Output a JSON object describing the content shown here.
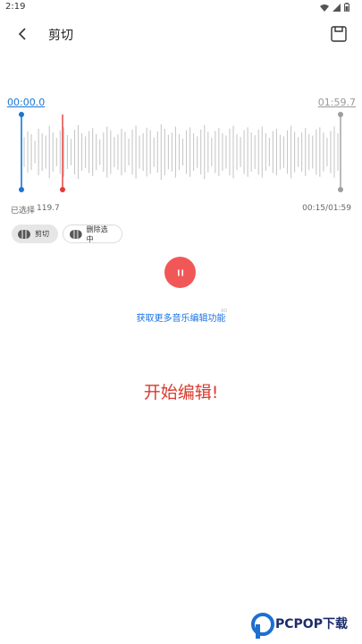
{
  "status_bar": {
    "time": "2:19",
    "icons": [
      "wifi-icon",
      "signal-icon",
      "battery-icon"
    ]
  },
  "app_bar": {
    "title": "剪切",
    "back_icon": "chevron-left-icon",
    "save_icon": "save-icon"
  },
  "timeline": {
    "start_time": "00:00.0",
    "end_time": "01:59.7"
  },
  "waveform": {
    "colors": {
      "wave": "#c8c8c8",
      "start_handle": "#1976d2",
      "playhead": "#e53935",
      "end_handle": "#9e9e9e"
    },
    "playhead_position_fraction": 0.125,
    "amplitudes": [
      0.4,
      0.55,
      0.48,
      0.3,
      0.62,
      0.5,
      0.44,
      0.7,
      0.52,
      0.38,
      0.58,
      0.66,
      0.45,
      0.35,
      0.6,
      0.72,
      0.5,
      0.42,
      0.56,
      0.64,
      0.48,
      0.34,
      0.52,
      0.68,
      0.58,
      0.4,
      0.47,
      0.62,
      0.54,
      0.36,
      0.6,
      0.7,
      0.44,
      0.5,
      0.65,
      0.58,
      0.39,
      0.55,
      0.74,
      0.62,
      0.46,
      0.52,
      0.68,
      0.48,
      0.36,
      0.58,
      0.66,
      0.5,
      0.42,
      0.6,
      0.72,
      0.54,
      0.38,
      0.56,
      0.64,
      0.5,
      0.44,
      0.62,
      0.7,
      0.48,
      0.4,
      0.58,
      0.66,
      0.52,
      0.45,
      0.6,
      0.68,
      0.5,
      0.38,
      0.56,
      0.62,
      0.46,
      0.42,
      0.58,
      0.7,
      0.54,
      0.4,
      0.52,
      0.64,
      0.48,
      0.44,
      0.6,
      0.66,
      0.52,
      0.38,
      0.56,
      0.68,
      0.5
    ]
  },
  "selection": {
    "label": "已选择",
    "value": "119.7",
    "position_readout": "00:15/01:59"
  },
  "actions": {
    "cut_label": "剪切",
    "delete_selected_label": "删除选中"
  },
  "player": {
    "state": "playing",
    "button_icon": "pause-icon",
    "color": "#f25757"
  },
  "promo": {
    "link_text": "获取更多音乐编辑功能",
    "ad_tag": "AD"
  },
  "banner": {
    "text": "开始编辑!"
  },
  "watermark": {
    "text": "PCPOP下载"
  }
}
